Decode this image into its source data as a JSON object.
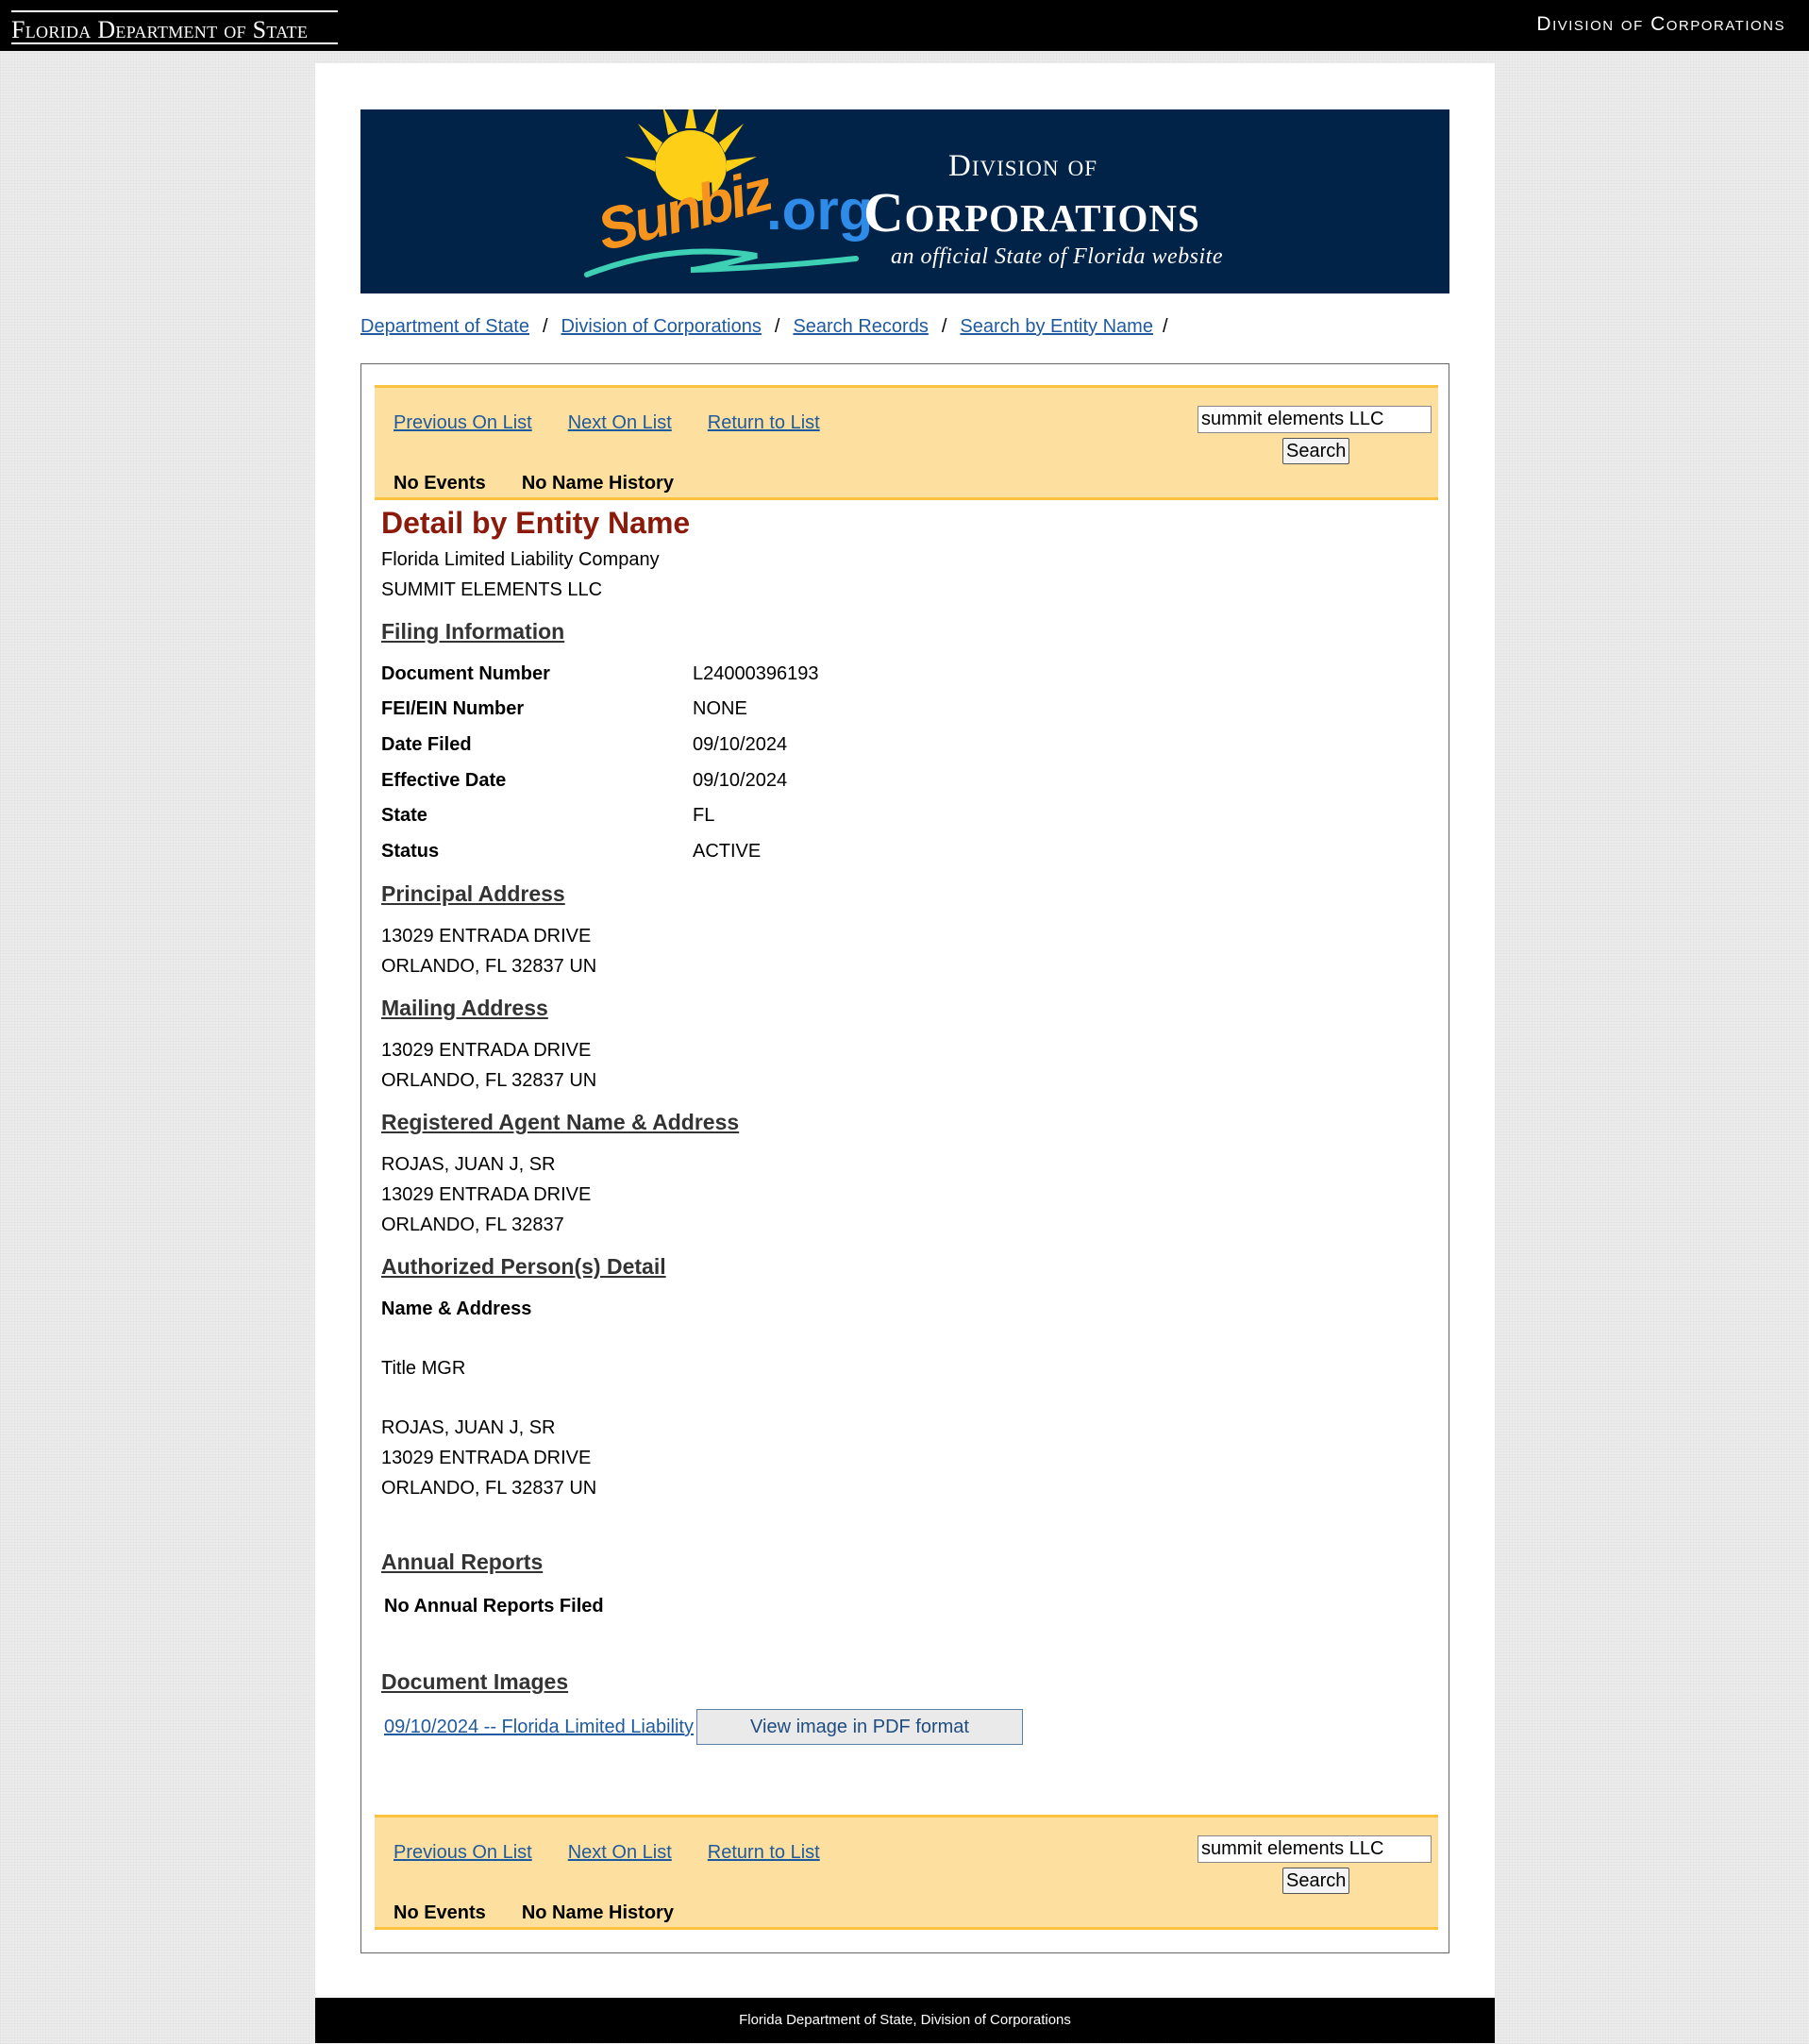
{
  "header": {
    "left_logo_text": "Florida Department of State",
    "right_title": "Division of Corporations"
  },
  "banner": {
    "brand": "Sunbiz",
    "brand_tld": ".org",
    "division": "Division of",
    "corporations": "Corporations",
    "tagline": "an official State of Florida website"
  },
  "breadcrumb": [
    {
      "label": "Department of State"
    },
    {
      "label": "Division of Corporations"
    },
    {
      "label": "Search Records"
    },
    {
      "label": "Search by Entity Name"
    }
  ],
  "breadcrumb_sep": "/",
  "nav": {
    "previous": "Previous On List",
    "next": "Next On List",
    "return": "Return to List",
    "no_events": "No Events",
    "no_name_history": "No Name History",
    "search_value": "summit elements LLC",
    "search_button": "Search"
  },
  "detail": {
    "title": "Detail by Entity Name",
    "entity_type": "Florida Limited Liability Company",
    "entity_name": "SUMMIT ELEMENTS LLC",
    "filing_heading": "Filing Information",
    "filing": [
      {
        "label": "Document Number",
        "value": "L24000396193"
      },
      {
        "label": "FEI/EIN Number",
        "value": "NONE"
      },
      {
        "label": "Date Filed",
        "value": "09/10/2024"
      },
      {
        "label": "Effective Date",
        "value": "09/10/2024"
      },
      {
        "label": "State",
        "value": "FL"
      },
      {
        "label": "Status",
        "value": "ACTIVE"
      }
    ],
    "principal_heading": "Principal Address",
    "principal": [
      "13029 ENTRADA DRIVE",
      "ORLANDO, FL 32837 UN"
    ],
    "mailing_heading": "Mailing Address",
    "mailing": [
      "13029 ENTRADA DRIVE",
      "ORLANDO, FL 32837 UN"
    ],
    "agent_heading": "Registered Agent Name & Address",
    "agent": [
      "ROJAS, JUAN J, SR",
      "13029 ENTRADA DRIVE",
      "ORLANDO, FL 32837"
    ],
    "authorized_heading": "Authorized Person(s) Detail",
    "authorized_sub": "Name & Address",
    "authorized_title": "Title MGR",
    "authorized": [
      "ROJAS, JUAN J, SR",
      "13029 ENTRADA DRIVE",
      "ORLANDO, FL 32837 UN"
    ],
    "annual_heading": "Annual Reports",
    "annual_text": "No Annual Reports Filed",
    "images_heading": "Document Images",
    "image_link": "09/10/2024 -- Florida Limited Liability",
    "image_button": "View image in PDF format"
  },
  "footer": {
    "text": "Florida Department of State, Division of Corporations"
  },
  "colors": {
    "banner_bg": "#002347",
    "nav_bg": "#fddf9f",
    "nav_border": "#fcc23f",
    "title_red": "#8b1a0b",
    "link_blue": "#1f5a9e"
  }
}
